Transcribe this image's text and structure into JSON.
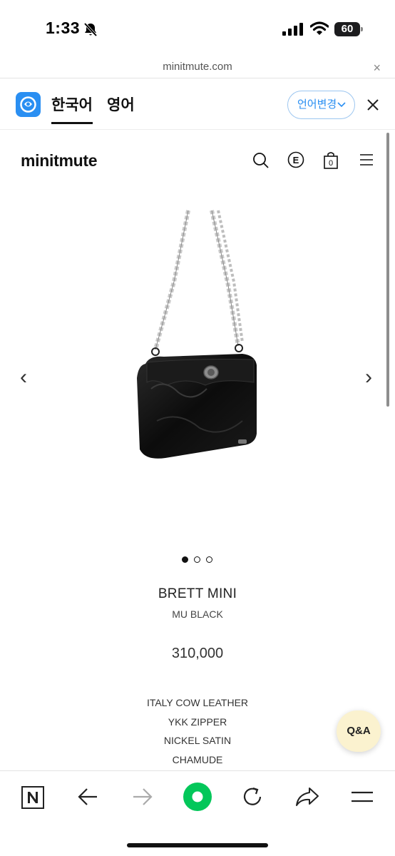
{
  "status": {
    "time": "1:33",
    "battery": "60",
    "icons": [
      "bell-slash-icon",
      "signal-icon",
      "wifi-icon",
      "battery-icon"
    ]
  },
  "browser": {
    "url": "minitmute.com",
    "close": "×"
  },
  "translate": {
    "tab_korean": "한국어",
    "tab_english": "영어",
    "change_language": "언어변경",
    "close": "×",
    "accent": "#2a8ff2"
  },
  "site": {
    "brand": "minitmute",
    "icons": [
      "search-icon",
      "e-circle-icon",
      "shopping-bag-icon",
      "menu-icon"
    ],
    "cart_count": "0"
  },
  "carousel": {
    "prev": "‹",
    "next": "›",
    "total_slides": 3,
    "active_slide": 1
  },
  "product": {
    "name": "BRETT MINI",
    "color": "MU BLACK",
    "price": "310,000",
    "specs": [
      "ITALY COW LEATHER",
      "YKK ZIPPER",
      "NICKEL SATIN",
      "CHAMUDE"
    ]
  },
  "qa": {
    "label": "Q&A",
    "bg": "#fbf2cf"
  },
  "toolbar": {
    "icons": [
      "naver-n-icon",
      "back-arrow-icon",
      "forward-arrow-icon",
      "green-home-icon",
      "reload-icon",
      "share-icon",
      "menu-icon"
    ],
    "green": "#03c75a"
  }
}
